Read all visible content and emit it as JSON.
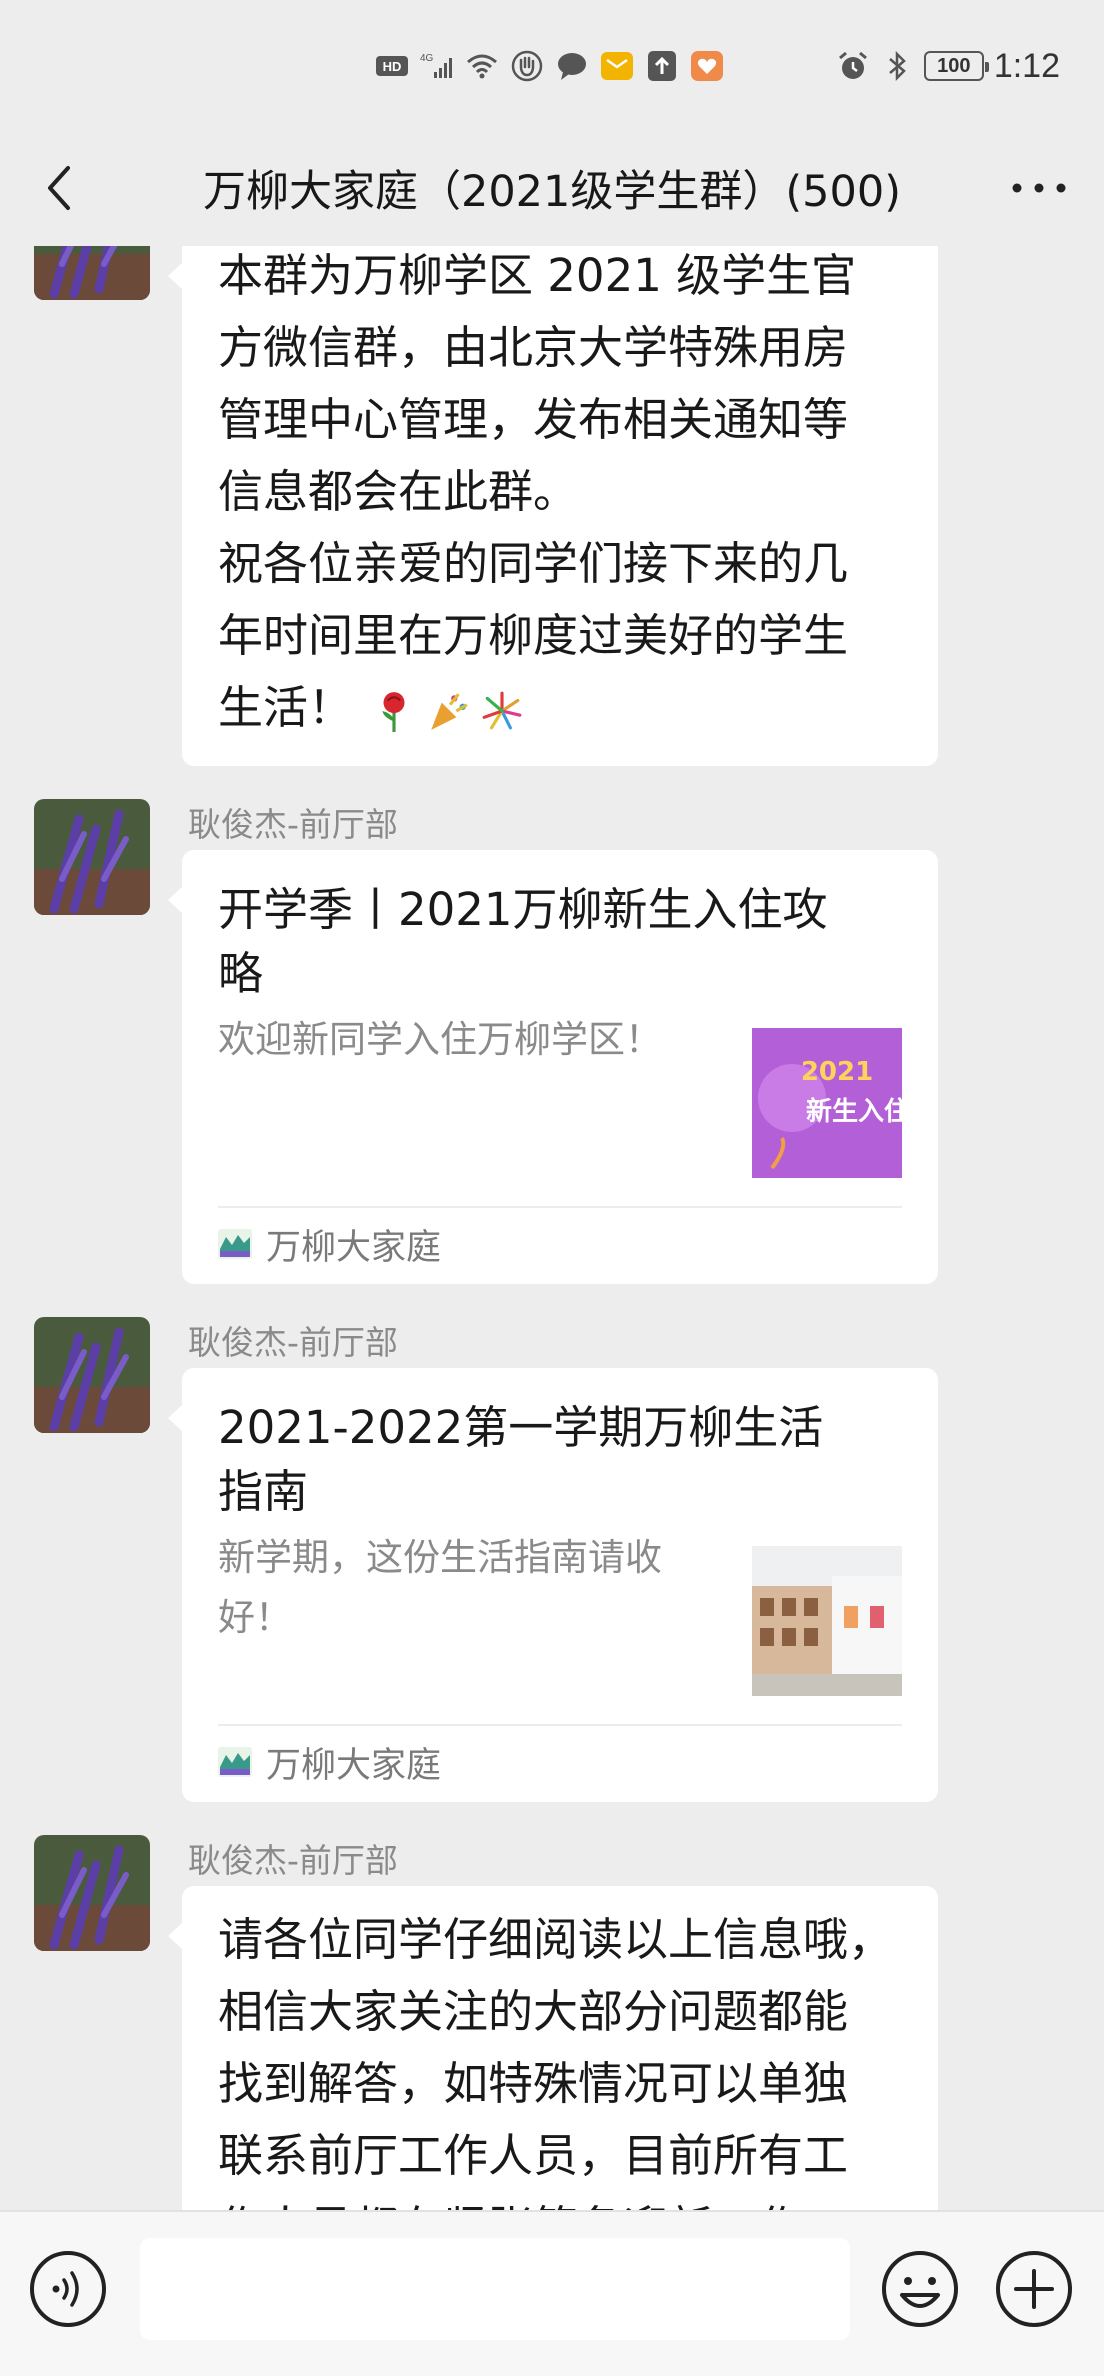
{
  "status_bar": {
    "time": "1:12",
    "battery": "100",
    "hd_label": "HD",
    "network_label": "4G"
  },
  "header": {
    "title": "万柳大家庭（2021级学生群）(500)",
    "back_icon": "chevron-left-icon",
    "more_icon": "more-dots-icon"
  },
  "messages": [
    {
      "type": "text",
      "text": "本群为万柳学区 2021 级学生官\n方微信群，由北京大学特殊用房\n管理中心管理，发布相关通知等\n信息都会在此群。\n祝各位亲爱的同学们接下来的几\n年时间里在万柳度过美好的学生\n生活！",
      "emojis": [
        "rose-emoji",
        "party-popper-emoji",
        "fireworks-emoji"
      ]
    },
    {
      "type": "link",
      "sender": "耿俊杰-前厅部",
      "title": "开学季丨2021万柳新生入住攻\n略",
      "description": "欢迎新同学入住万柳学区！",
      "thumb_text_line1": "2021",
      "thumb_text_line2": "新生入住",
      "source": "万柳大家庭"
    },
    {
      "type": "link",
      "sender": "耿俊杰-前厅部",
      "title": "2021-2022第一学期万柳生活\n指南",
      "description": "新学期，这份生活指南请收\n好！",
      "source": "万柳大家庭"
    },
    {
      "type": "text",
      "sender": "耿俊杰-前厅部",
      "text": "请各位同学仔细阅读以上信息哦，\n相信大家关注的大部分问题都能\n找到解答，如特殊情况可以单独\n联系前厅工作人员，目前所有工\n作人员都在紧张筹备迎新工作"
    }
  ],
  "input_bar": {
    "voice_icon": "voice-icon",
    "placeholder": "",
    "emoji_icon": "emoji-icon",
    "plus_icon": "plus-icon"
  },
  "colors": {
    "background": "#ededed",
    "bubble": "#ffffff",
    "name_text": "#8a8a8a",
    "input_bar": "#f7f7f7"
  }
}
